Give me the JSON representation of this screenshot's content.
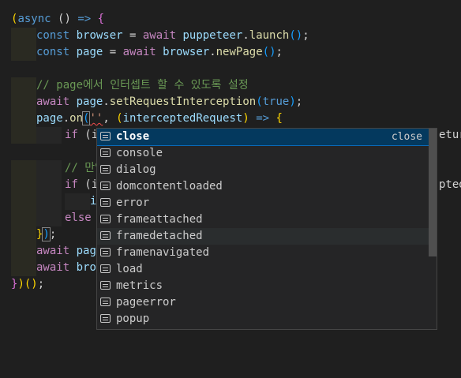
{
  "code": {
    "l1": {
      "open_paren": "(",
      "async": "async",
      "params": " () ",
      "arrow": "=>",
      "brace": " {"
    },
    "l2": {
      "const": "const",
      "name": " browser ",
      "eq": "= ",
      "await": "await",
      "obj": " puppeteer",
      "dot": ".",
      "fn": "launch",
      "parens": "()",
      "semi": ";"
    },
    "l3": {
      "const": "const",
      "name": " page ",
      "eq": "= ",
      "await": "await",
      "obj": " browser",
      "dot": ".",
      "fn": "newPage",
      "parens": "()",
      "semi": ";"
    },
    "l5": {
      "comment": "// page에서 인터셉트 할 수 있도록 설정"
    },
    "l6": {
      "await": "await",
      "obj": " page",
      "dot": ".",
      "fn": "setRequestInterception",
      "open": "(",
      "arg": "true",
      "close": ")",
      "semi": ";"
    },
    "l7": {
      "obj": "page",
      "dot": ".",
      "fn": "on",
      "open": "(",
      "str": "''",
      "comma": ", ",
      "paren2": "(",
      "param": "interceptedRequest",
      "paren2c": ")",
      "arrow": " => ",
      "brace": "{"
    },
    "l8": {
      "kw": "if",
      "rest": " (i",
      "tail": "etur"
    },
    "l10": {
      "comment": "// 만약"
    },
    "l11": {
      "kw": "if",
      "rest": " (i",
      "tail": "pted"
    },
    "l12": {
      "text": "i"
    },
    "l13": {
      "kw": "else",
      "rest": " "
    },
    "l14": {
      "brace": "}",
      "close": ")",
      "semi": ";"
    },
    "l15": {
      "await": "await",
      "rest": " pag"
    },
    "l16": {
      "await": "await",
      "rest": " bro"
    },
    "l17": {
      "brace": "}",
      "close": ")",
      "parens": "()",
      "semi": ";"
    }
  },
  "suggest": {
    "items": [
      {
        "label": "close",
        "detail": "close"
      },
      {
        "label": "console"
      },
      {
        "label": "dialog"
      },
      {
        "label": "domcontentloaded"
      },
      {
        "label": "error"
      },
      {
        "label": "frameattached"
      },
      {
        "label": "framedetached"
      },
      {
        "label": "framenavigated"
      },
      {
        "label": "load"
      },
      {
        "label": "metrics"
      },
      {
        "label": "pageerror"
      },
      {
        "label": "popup"
      }
    ],
    "selected_index": 0,
    "hovered_index": 6,
    "item_icon": "text-lines-icon"
  },
  "colors": {
    "background": "#1f1f1f",
    "keyword": "#569cd6",
    "control_keyword": "#c586c0",
    "variable": "#9cdcfe",
    "function": "#dcdcaa",
    "comment": "#6a9955",
    "string": "#ce9178",
    "selection": "#04395e"
  }
}
